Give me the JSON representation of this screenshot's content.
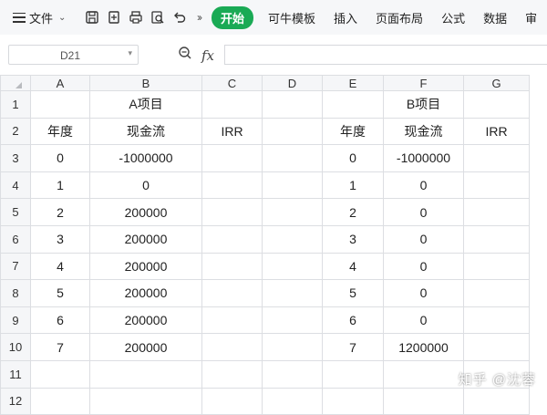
{
  "ribbon": {
    "file_label": "文件",
    "tabs": [
      {
        "label": "开始",
        "active": true
      },
      {
        "label": "可牛模板",
        "active": false
      },
      {
        "label": "插入",
        "active": false
      },
      {
        "label": "页面布局",
        "active": false
      },
      {
        "label": "公式",
        "active": false
      },
      {
        "label": "数据",
        "active": false
      },
      {
        "label": "审",
        "active": false
      }
    ],
    "active_tab_color": "#1aaa55"
  },
  "formula_bar": {
    "name_box": "D21",
    "fx_label": "fx",
    "formula": ""
  },
  "sheet": {
    "columns": [
      "A",
      "B",
      "C",
      "D",
      "E",
      "F",
      "G"
    ],
    "selected_column": "D",
    "row_numbers": [
      "1",
      "2",
      "3",
      "4",
      "5",
      "6",
      "7",
      "8",
      "9",
      "10",
      "11",
      "12"
    ],
    "rows": [
      [
        "",
        "A项目",
        "",
        "",
        "",
        "B项目",
        ""
      ],
      [
        "年度",
        "现金流",
        "IRR",
        "",
        "年度",
        "现金流",
        "IRR"
      ],
      [
        "0",
        "-1000000",
        "",
        "",
        "0",
        "-1000000",
        ""
      ],
      [
        "1",
        "0",
        "",
        "",
        "1",
        "0",
        ""
      ],
      [
        "2",
        "200000",
        "",
        "",
        "2",
        "0",
        ""
      ],
      [
        "3",
        "200000",
        "",
        "",
        "3",
        "0",
        ""
      ],
      [
        "4",
        "200000",
        "",
        "",
        "4",
        "0",
        ""
      ],
      [
        "5",
        "200000",
        "",
        "",
        "5",
        "0",
        ""
      ],
      [
        "6",
        "200000",
        "",
        "",
        "6",
        "0",
        ""
      ],
      [
        "7",
        "200000",
        "",
        "",
        "7",
        "1200000",
        ""
      ],
      [
        "",
        "",
        "",
        "",
        "",
        "",
        ""
      ],
      [
        "",
        "",
        "",
        "",
        "",
        "",
        ""
      ]
    ]
  },
  "watermark": "知乎 @沈蓉"
}
